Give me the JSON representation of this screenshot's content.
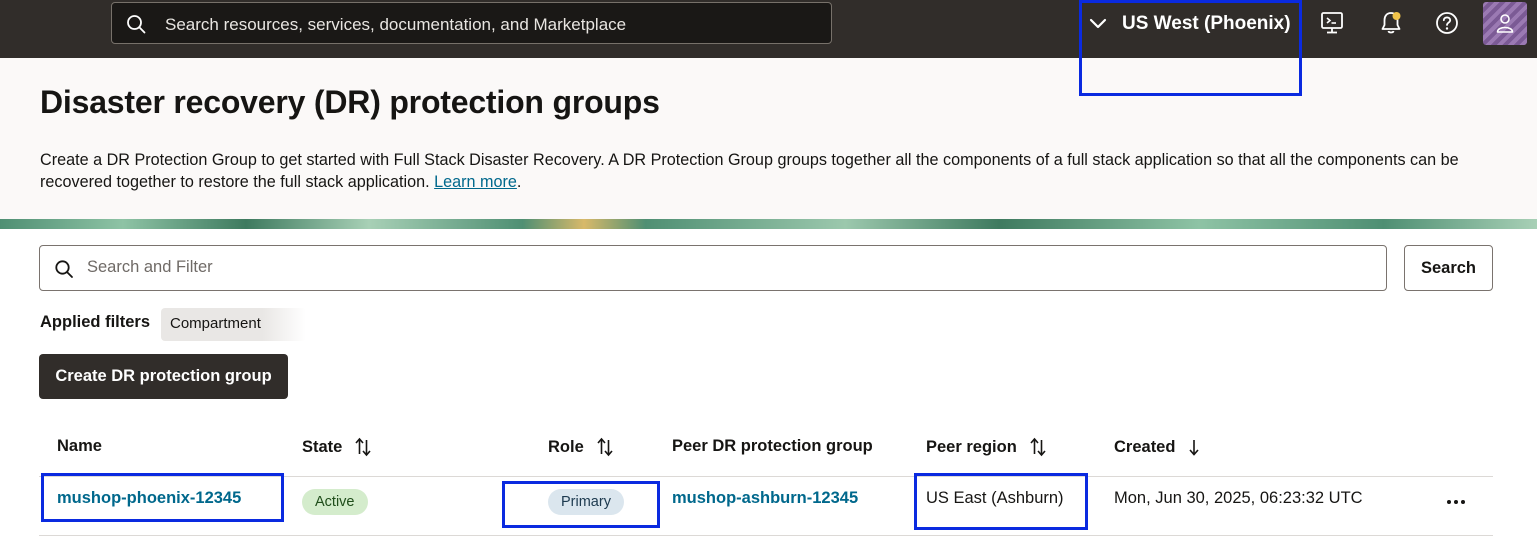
{
  "topbar": {
    "search_placeholder": "Search resources, services, documentation, and Marketplace",
    "region_label": "US West (Phoenix)",
    "icons": [
      "chevron-down-icon",
      "cloud-shell-icon",
      "bell-icon",
      "help-icon",
      "user-icon"
    ],
    "notification_dot_color": "#f0c34a"
  },
  "header": {
    "title": "Disaster recovery (DR) protection groups",
    "description": "Create a DR Protection Group to get started with Full Stack Disaster Recovery. A DR Protection Group groups together all the components of a full stack application so that all the components can be recovered together to restore the full stack application.",
    "learn_more": "Learn more",
    "learn_more_suffix": "."
  },
  "filters": {
    "search_placeholder": "Search and Filter",
    "search_button": "Search",
    "applied_label": "Applied filters",
    "chips": [
      "Compartment"
    ]
  },
  "actions": {
    "create_button": "Create DR protection group"
  },
  "table": {
    "columns": [
      "Name",
      "State",
      "Role",
      "Peer DR protection group",
      "Peer region",
      "Created"
    ],
    "rows": [
      {
        "name": "mushop-phoenix-12345",
        "state": "Active",
        "role": "Primary",
        "peer_group": "mushop-ashburn-12345",
        "peer_region": "US East (Ashburn)",
        "created": "Mon, Jun 30, 2025, 06:23:32 UTC"
      }
    ]
  },
  "colors": {
    "topbar": "#312d2a",
    "link": "#00688c",
    "active_badge": "#d4eccc",
    "primary_badge": "#dbe6ee",
    "highlight_box": "#0a2ae0"
  }
}
